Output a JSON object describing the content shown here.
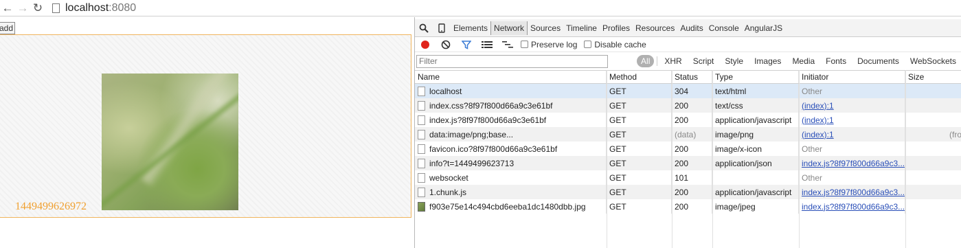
{
  "browser": {
    "url_host": "localhost",
    "url_port": ":8080",
    "back_glyph": "←",
    "forward_glyph": "→",
    "reload_glyph": "↻"
  },
  "app": {
    "add_label": "add",
    "timestamp": "1449499626972"
  },
  "devtools": {
    "tabs": [
      "Elements",
      "Network",
      "Sources",
      "Timeline",
      "Profiles",
      "Resources",
      "Audits",
      "Console",
      "AngularJS"
    ],
    "active_tab": "Network",
    "preserve_log_label": "Preserve log",
    "disable_cache_label": "Disable cache",
    "filter_placeholder": "Filter",
    "type_filters": [
      "All",
      "XHR",
      "Script",
      "Style",
      "Images",
      "Media",
      "Fonts",
      "Documents",
      "WebSockets"
    ],
    "columns": [
      "Name",
      "Method",
      "Status",
      "Type",
      "Initiator",
      "Size"
    ],
    "rows": [
      {
        "name": "localhost",
        "method": "GET",
        "status": "304",
        "type": "text/html",
        "initiator": "Other",
        "initiator_link": false,
        "size": "",
        "icon": "file"
      },
      {
        "name": "index.css?8f97f800d66a9c3e61bf",
        "method": "GET",
        "status": "200",
        "type": "text/css",
        "initiator": "(index):1",
        "initiator_link": true,
        "size": "",
        "icon": "file"
      },
      {
        "name": "index.js?8f97f800d66a9c3e61bf",
        "method": "GET",
        "status": "200",
        "type": "application/javascript",
        "initiator": "(index):1",
        "initiator_link": true,
        "size": "",
        "icon": "file"
      },
      {
        "name": "data:image/png;base...",
        "method": "GET",
        "status": "(data)",
        "type": "image/png",
        "initiator": "(index):1",
        "initiator_link": true,
        "size": "(fro",
        "icon": "file"
      },
      {
        "name": "favicon.ico?8f97f800d66a9c3e61bf",
        "method": "GET",
        "status": "200",
        "type": "image/x-icon",
        "initiator": "Other",
        "initiator_link": false,
        "size": "",
        "icon": "file"
      },
      {
        "name": "info?t=1449499623713",
        "method": "GET",
        "status": "200",
        "type": "application/json",
        "initiator": "index.js?8f97f800d66a9c3...",
        "initiator_link": true,
        "size": "",
        "icon": "file"
      },
      {
        "name": "websocket",
        "method": "GET",
        "status": "101",
        "type": "",
        "initiator": "Other",
        "initiator_link": false,
        "size": "",
        "icon": "file"
      },
      {
        "name": "1.chunk.js",
        "method": "GET",
        "status": "200",
        "type": "application/javascript",
        "initiator": "index.js?8f97f800d66a9c3...",
        "initiator_link": true,
        "size": "",
        "icon": "file"
      },
      {
        "name": "f903e75e14c494cbd6eeba1dc1480dbb.jpg",
        "method": "GET",
        "status": "200",
        "type": "image/jpeg",
        "initiator": "index.js?8f97f800d66a9c3...",
        "initiator_link": true,
        "size": "",
        "icon": "image"
      }
    ],
    "selected_row": 0,
    "colors": {
      "record": "#e0241b",
      "selected_row": "#dce9f7",
      "link": "#2a4fb8",
      "timestamp": "#f0a030",
      "app_border": "#f0b45c"
    }
  }
}
